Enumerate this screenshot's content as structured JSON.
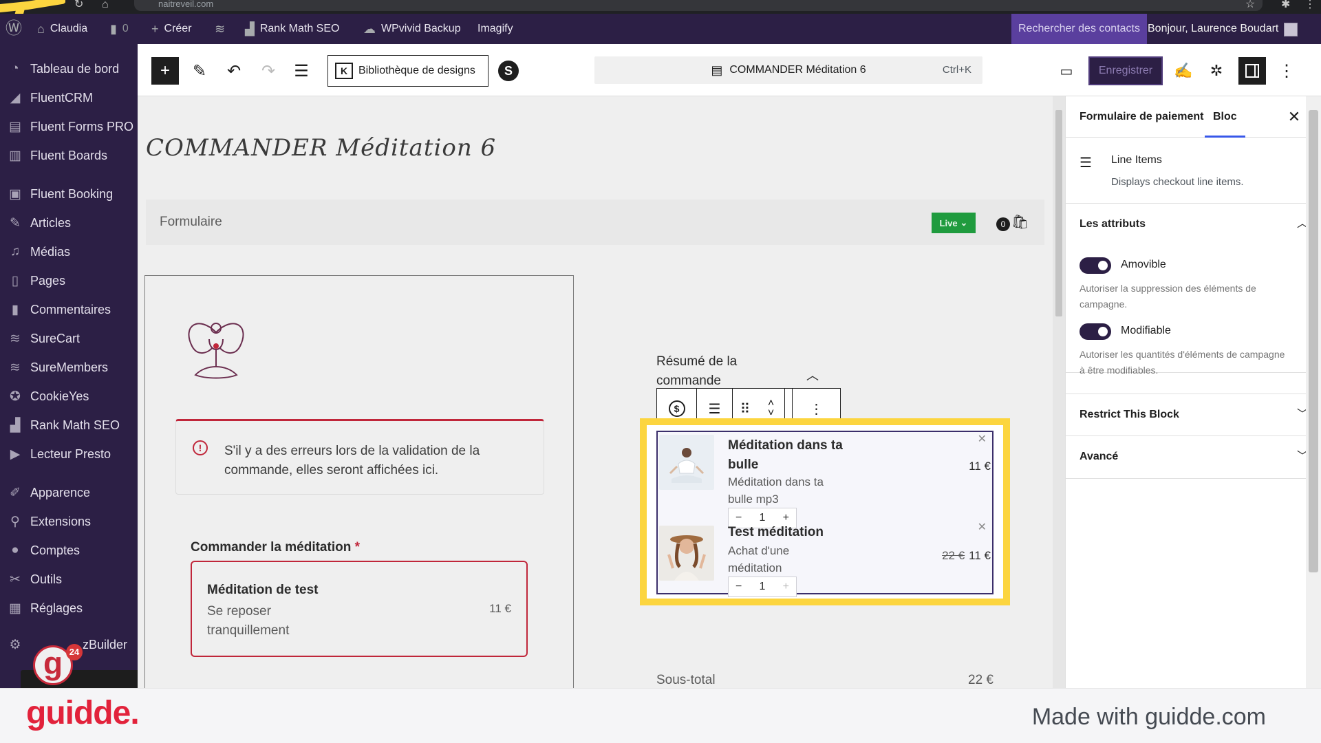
{
  "browser": {
    "url": "naitreveil.com"
  },
  "adminbar": {
    "site_name": "Claudia",
    "comments_count": "0",
    "create_label": "Créer",
    "rankmath_label": "Rank Math SEO",
    "wpvivid_label": "WPvivid Backup",
    "imagify_label": "Imagify",
    "search_contacts_label": "Rechercher des contacts",
    "greeting": "Bonjour, Laurence Boudart"
  },
  "sidebar": {
    "items": [
      {
        "label": "Tableau de bord",
        "icon": "dashboard-icon"
      },
      {
        "label": "FluentCRM",
        "icon": "fluentcrm-icon"
      },
      {
        "label": "Fluent Forms PRO",
        "icon": "forms-icon"
      },
      {
        "label": "Fluent Boards",
        "icon": "boards-icon"
      },
      {
        "label": "Fluent Booking",
        "icon": "booking-icon"
      },
      {
        "label": "Articles",
        "icon": "pin-icon"
      },
      {
        "label": "Médias",
        "icon": "media-icon"
      },
      {
        "label": "Pages",
        "icon": "pages-icon"
      },
      {
        "label": "Commentaires",
        "icon": "comment-icon"
      },
      {
        "label": "SureCart",
        "icon": "surecart-icon"
      },
      {
        "label": "SureMembers",
        "icon": "suremembers-icon"
      },
      {
        "label": "CookieYes",
        "icon": "cookie-icon"
      },
      {
        "label": "Rank Math SEO",
        "icon": "rankmath-icon"
      },
      {
        "label": "Lecteur Presto",
        "icon": "presto-icon"
      },
      {
        "label": "Apparence",
        "icon": "brush-icon"
      },
      {
        "label": "Extensions",
        "icon": "plugin-icon"
      },
      {
        "label": "Comptes",
        "icon": "user-icon"
      },
      {
        "label": "Outils",
        "icon": "wrench-icon"
      },
      {
        "label": "Réglages",
        "icon": "settings-icon"
      },
      {
        "label": "zBuilder",
        "icon": "gear-icon"
      }
    ],
    "notification_count": "24"
  },
  "toolbar": {
    "design_library_label": "Bibliothèque de designs",
    "command_title": "COMMANDER Méditation 6",
    "command_shortcut": "Ctrl+K",
    "save_label": "Enregistrer"
  },
  "canvas": {
    "page_title": "COMMANDER Méditation 6",
    "form_label": "Formulaire",
    "live_label": "Live",
    "cart_count": "0",
    "error_text": "S'il y a des erreurs lors de la validation de la commande, elles seront affichées ici.",
    "order_label": "Commander la méditation",
    "order_required": "*",
    "product": {
      "name": "Méditation de test",
      "description": "Se reposer tranquillement",
      "price": "11 €"
    },
    "summary_title": "Résumé de la commande",
    "line_items": [
      {
        "name": "Méditation dans ta bulle",
        "description": "Méditation dans ta bulle mp3",
        "old_price": "",
        "price": "11 €",
        "quantity": "1"
      },
      {
        "name": "Test méditation",
        "description": "Achat d'une méditation",
        "old_price": "22 €",
        "price": "11 €",
        "quantity": "1"
      }
    ],
    "subtotal_label": "Sous-total",
    "subtotal_value": "22 €"
  },
  "settings": {
    "tab_form": "Formulaire de paiement",
    "tab_block": "Bloc",
    "block_title": "Line Items",
    "block_desc": "Displays checkout line items.",
    "attributes_title": "Les attributs",
    "removable_label": "Amovible",
    "removable_help": "Autoriser la suppression des éléments de campagne.",
    "editable_label": "Modifiable",
    "editable_help": "Autoriser les quantités d'éléments de campagne à être modifiables.",
    "restrict_title": "Restrict This Block",
    "advanced_title": "Avancé"
  },
  "footer": {
    "brand": "guidde.",
    "made_with": "Made with guidde.com"
  },
  "colors": {
    "admin_bg": "#2c1f45",
    "highlight": "#fcd53f",
    "live": "#1f9b3e",
    "error": "#c0263a",
    "brand": "#e2223b"
  }
}
